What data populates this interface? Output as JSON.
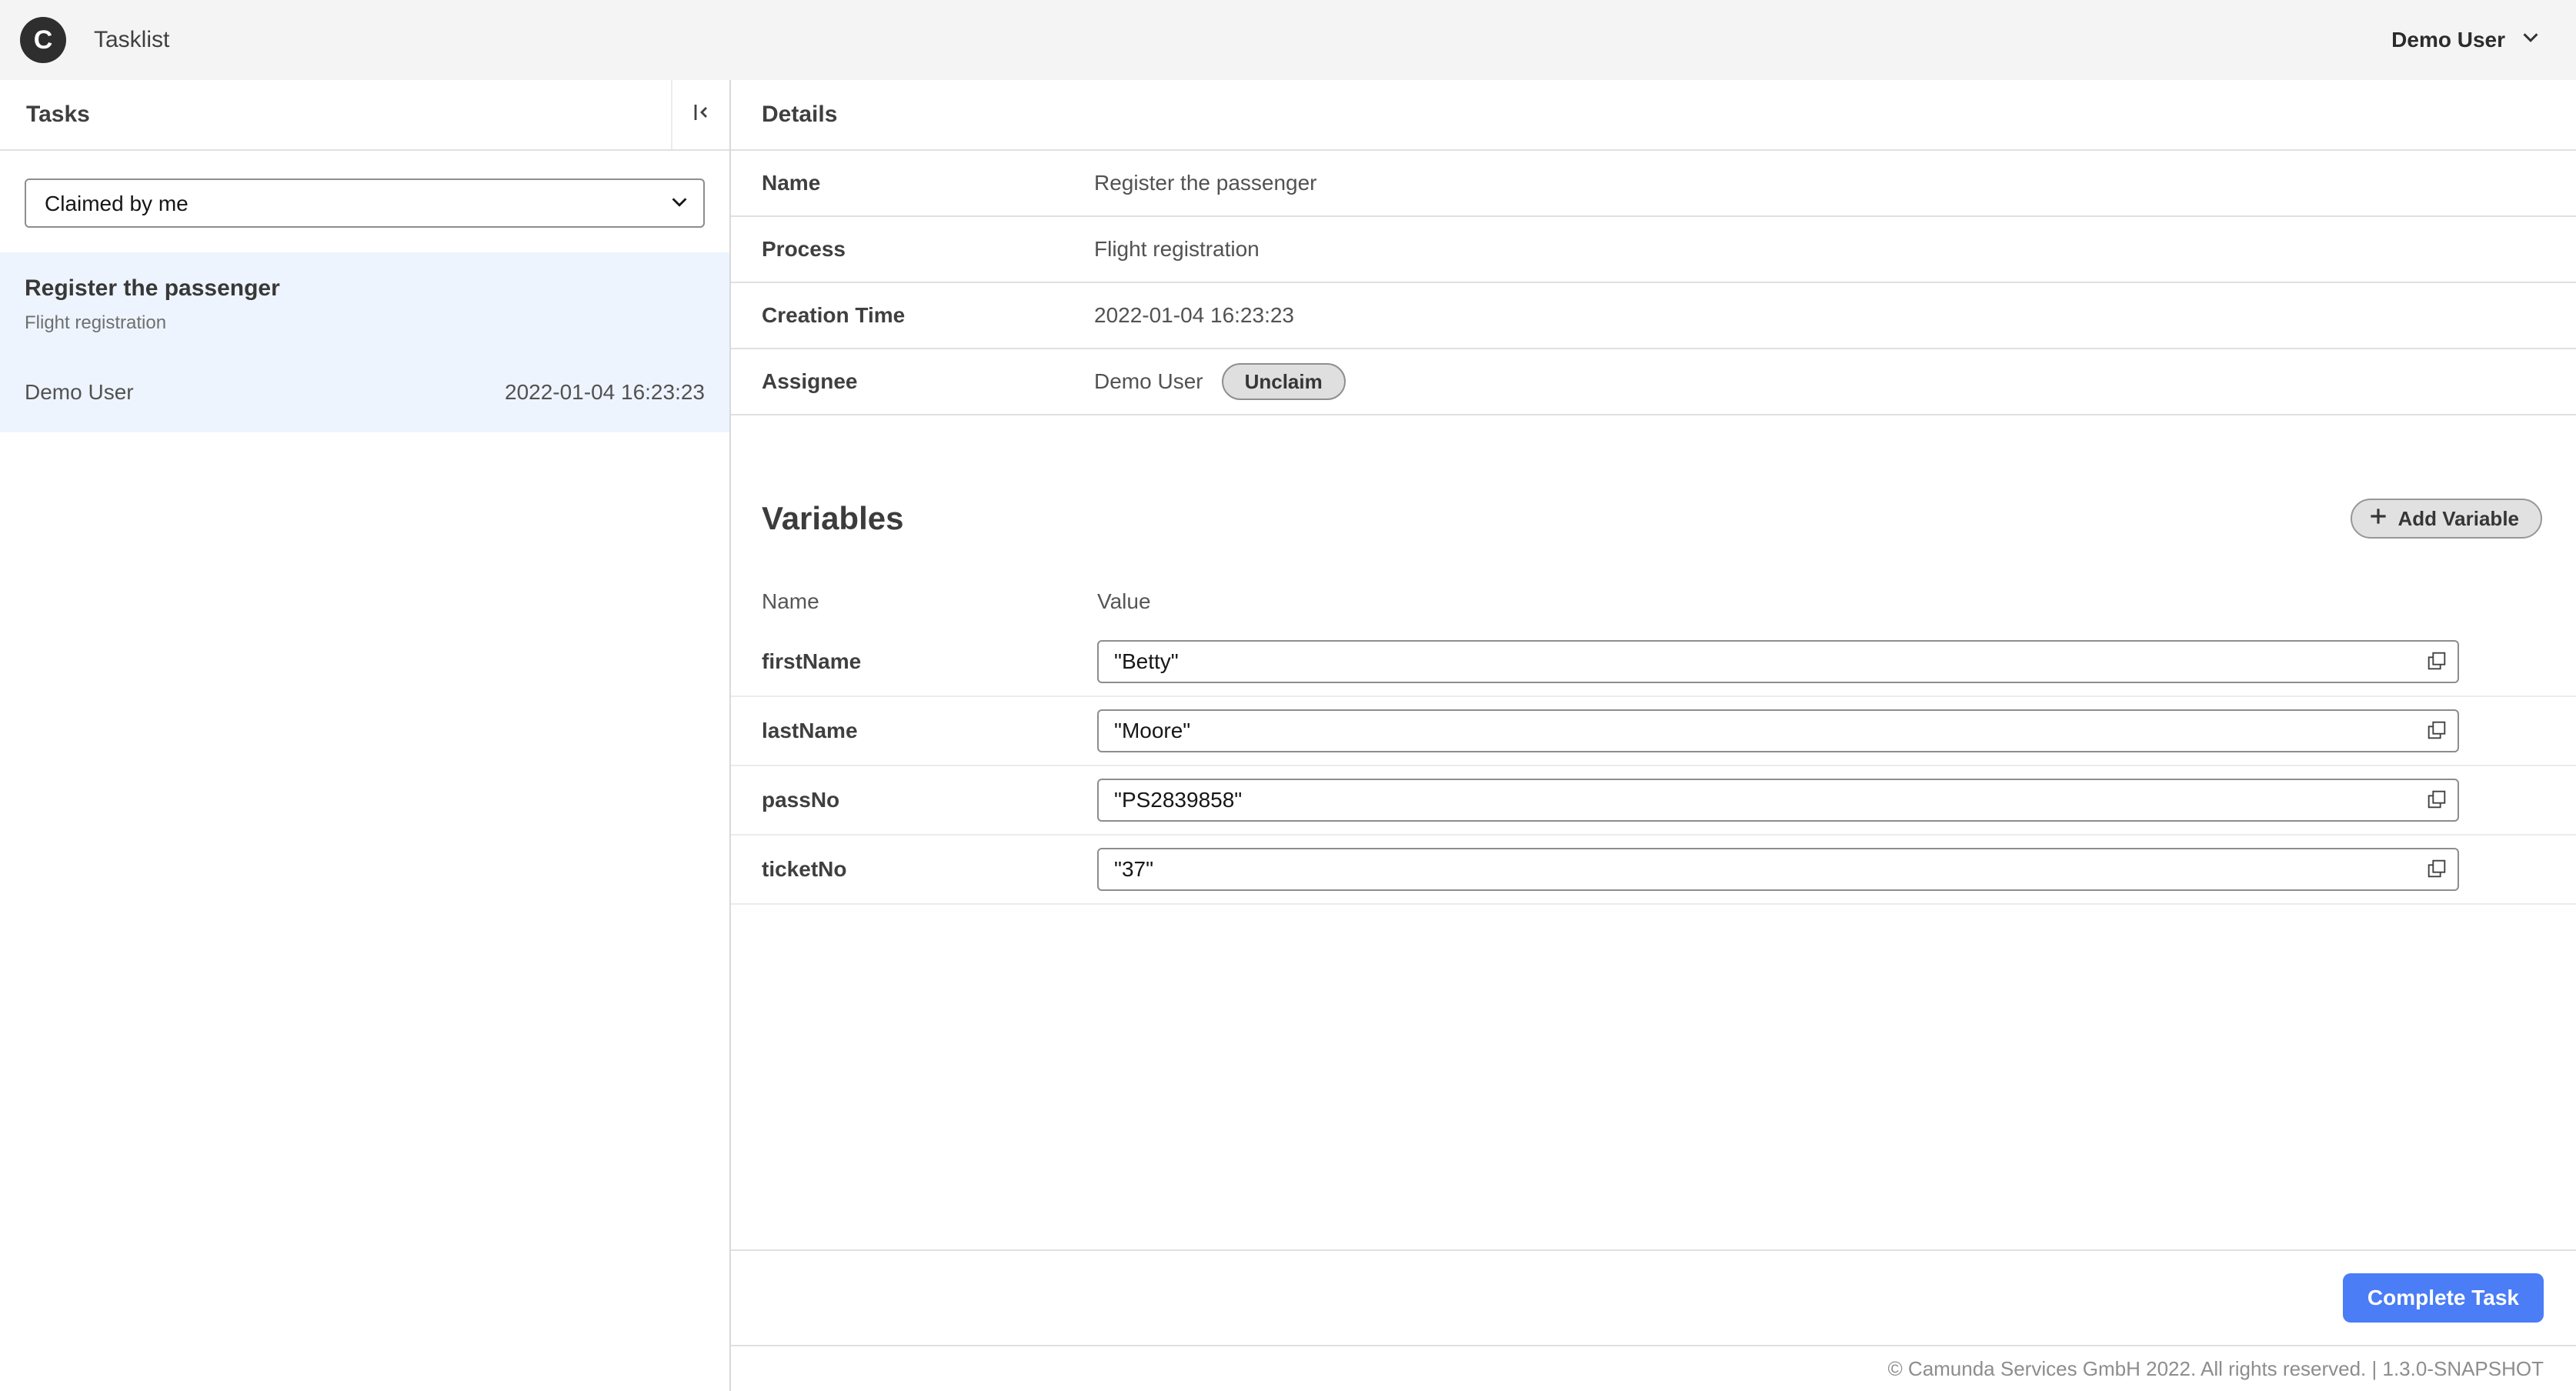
{
  "header": {
    "logo_text": "C",
    "app_title": "Tasklist",
    "user_name": "Demo User"
  },
  "tasks_panel": {
    "title": "Tasks",
    "filter_selected": "Claimed by me",
    "task": {
      "name": "Register the passenger",
      "process": "Flight registration",
      "assignee": "Demo User",
      "creation_time": "2022-01-04 16:23:23"
    }
  },
  "details": {
    "title": "Details",
    "fields": [
      {
        "label": "Name",
        "value": "Register the passenger"
      },
      {
        "label": "Process",
        "value": "Flight registration"
      },
      {
        "label": "Creation Time",
        "value": "2022-01-04 16:23:23"
      },
      {
        "label": "Assignee",
        "value": "Demo User"
      }
    ],
    "unclaim_label": "Unclaim"
  },
  "variables": {
    "title": "Variables",
    "add_button_label": "Add Variable",
    "col_name": "Name",
    "col_value": "Value",
    "rows": [
      {
        "name": "firstName",
        "value": "\"Betty\""
      },
      {
        "name": "lastName",
        "value": "\"Moore\""
      },
      {
        "name": "passNo",
        "value": "\"PS2839858\""
      },
      {
        "name": "ticketNo",
        "value": "\"37\""
      }
    ]
  },
  "actions": {
    "complete_label": "Complete Task"
  },
  "footer": {
    "copyright": "© Camunda Services GmbH 2022. All rights reserved. | 1.3.0-SNAPSHOT"
  },
  "colors": {
    "accent": "#4a7df6",
    "selected_task_bg": "#eef4fd",
    "topbar_bg": "#f4f4f5"
  }
}
